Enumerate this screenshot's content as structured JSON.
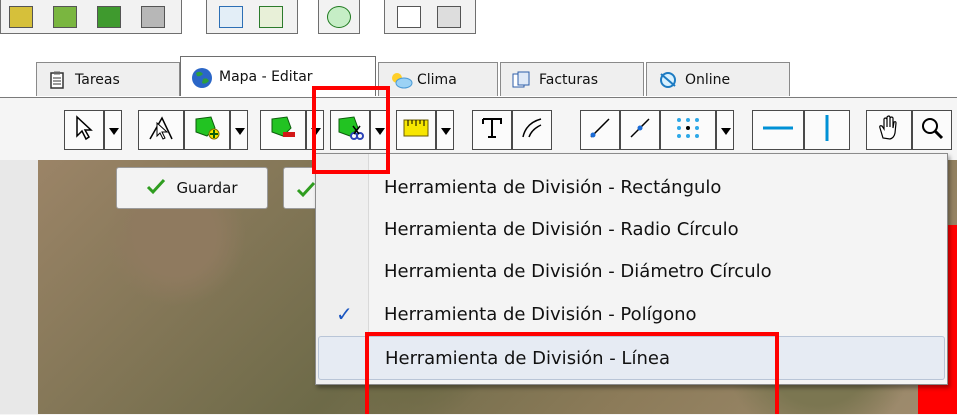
{
  "tabs": [
    {
      "label": "Tareas",
      "icon": "clipboard-icon"
    },
    {
      "label": "Mapa - Editar",
      "icon": "globe-icon",
      "active": true
    },
    {
      "label": "Clima",
      "icon": "weather-icon"
    },
    {
      "label": "Facturas",
      "icon": "invoice-icon"
    },
    {
      "label": "Online",
      "icon": "online-icon"
    }
  ],
  "action_buttons": {
    "save_label": "Guardar",
    "save_icon": "checkmark-icon"
  },
  "menu": {
    "items": [
      {
        "label": "Herramienta de División - Rectángulo",
        "checked": false
      },
      {
        "label": "Herramienta de División - Radio Círculo",
        "checked": false
      },
      {
        "label": "Herramienta de División - Diámetro Círculo",
        "checked": false
      },
      {
        "label": "Herramienta de División - Polígono",
        "checked": true
      },
      {
        "label": "Herramienta de División - Línea",
        "checked": false
      }
    ],
    "check_mark": "✓"
  },
  "colors": {
    "highlight": "#ff0000",
    "check": "#1a55c0",
    "tool_green": "#22c322",
    "tool_red": "#d31818",
    "ruler_yellow": "#f7e600",
    "guide_blue": "#0091d6"
  }
}
